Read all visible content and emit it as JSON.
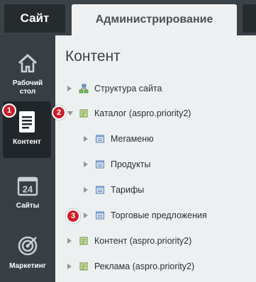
{
  "tabs": {
    "site": "Сайт",
    "admin": "Администрирование"
  },
  "sidebar": {
    "items": [
      {
        "label": "Рабочий\nстол",
        "icon": "home-icon"
      },
      {
        "label": "Контент",
        "icon": "document-icon",
        "active": true
      },
      {
        "label": "Сайты",
        "icon": "calendar-24-icon",
        "icon_text": "24"
      },
      {
        "label": "Маркетинг",
        "icon": "target-icon"
      }
    ]
  },
  "content": {
    "title": "Контент",
    "tree": [
      {
        "label": "Структура сайта",
        "icon": "site-structure-icon",
        "expanded": false
      },
      {
        "label": "Каталог (aspro.priority2)",
        "icon": "iblock-type-icon",
        "expanded": true
      },
      {
        "label": "Мегаменю",
        "icon": "iblock-icon",
        "expanded": false
      },
      {
        "label": "Продукты",
        "icon": "iblock-icon",
        "expanded": false
      },
      {
        "label": "Тарифы",
        "icon": "iblock-icon",
        "expanded": false
      },
      {
        "label": "Торговые предложения",
        "icon": "iblock-icon",
        "expanded": false
      },
      {
        "label": "Контент (aspro.priority2)",
        "icon": "iblock-type-icon",
        "expanded": false
      },
      {
        "label": "Реклама (aspro.priority2)",
        "icon": "iblock-type-icon",
        "expanded": false
      }
    ]
  },
  "badges": [
    "1",
    "2",
    "3"
  ],
  "colors": {
    "badge": "#c8202a",
    "sidebar": "#383f44",
    "content_bg": "#edf0f1"
  }
}
